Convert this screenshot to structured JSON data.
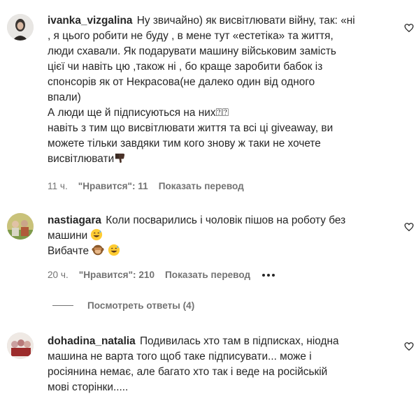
{
  "comments": [
    {
      "username": "ivanka_vizgalina",
      "lines": [
        "Ну звичайно) як висвітлювати війну, так: «ні",
        ", я цього робити не буду , в мене тут «естетіка» та життя,",
        "люди схавали. Як подарувати машину військовим замість",
        "цієї чи навіть цю ,також ні , бо краще заробити бабок із",
        "спонсорів як от Некрасова(не далеко один від одного",
        "впали)",
        "А люди ще й підписуються на них⍰⍰",
        "навіть з тим що висвітлювати життя та всі ці giveaway, ви",
        "можете тільки завдяки тим кого знову ж таки не хочете",
        "висвітлювати"
      ],
      "end_emoji": "thumbs-down-dark-skin",
      "time": "11 ч.",
      "likes": "\"Нравится\": 11",
      "translate": "Показать перевод"
    },
    {
      "username": "nastiagara",
      "lines": [
        "Коли посварились і чоловік пішов на роботу без",
        "машини",
        "Вибачте"
      ],
      "line2_emoji": "grinning-sweat",
      "line3_emojis": [
        "see-no-evil-monkey",
        "grinning-sweat"
      ],
      "time": "20 ч.",
      "likes": "\"Нравится\": 210",
      "translate": "Показать перевод"
    },
    {
      "username": "dohadina_natalia",
      "lines": [
        "Подивилась хто там в підписках, ніодна",
        "машина не варта того щоб таке підписувати... може і",
        "росіянина немає, але багато хто так і веде на російській",
        "мові сторінки....."
      ]
    }
  ],
  "view_replies": "Посмотреть ответы (4)",
  "colors": {
    "text": "#262626",
    "secondary": "#737373"
  }
}
